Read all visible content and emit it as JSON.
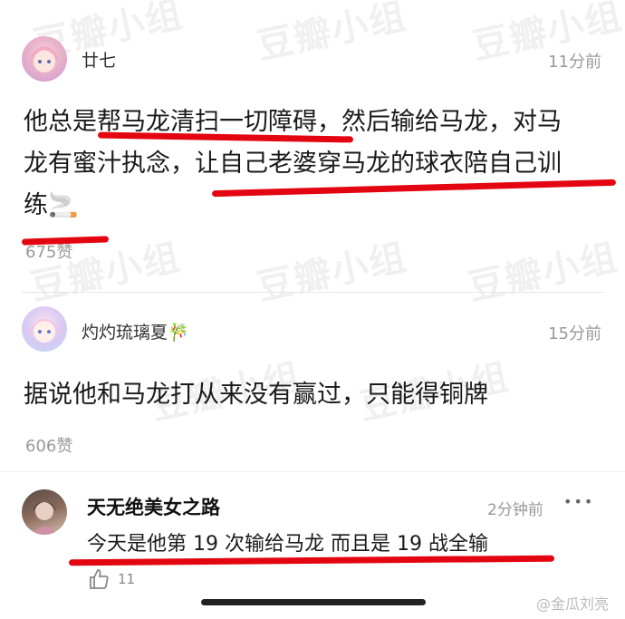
{
  "watermark": "豆瓣小组",
  "comments": [
    {
      "username": "廿七",
      "time": "11分前",
      "lines": [
        "他总是帮马龙清扫一切障碍，然后输给马龙，对马",
        "龙有蜜汁执念，让自己老婆穿马龙的球衣陪自己训",
        "练🚬"
      ],
      "likes": "675赞"
    },
    {
      "username": "灼灼琉璃夏🎋",
      "time": "15分前",
      "lines": [
        "据说他和马龙打从来没有赢过，只能得铜牌"
      ],
      "likes": "606赞"
    }
  ],
  "weibo_comment": {
    "username": "天无绝美女之路",
    "time": "2分钟前",
    "more_label": "•••",
    "text": "今天是他第 19 次输给马龙 而且是 19 战全输",
    "likes": "11"
  },
  "credit": "@金瓜刘亮",
  "colors": {
    "highlight": "#e3050f",
    "muted": "#999999"
  }
}
